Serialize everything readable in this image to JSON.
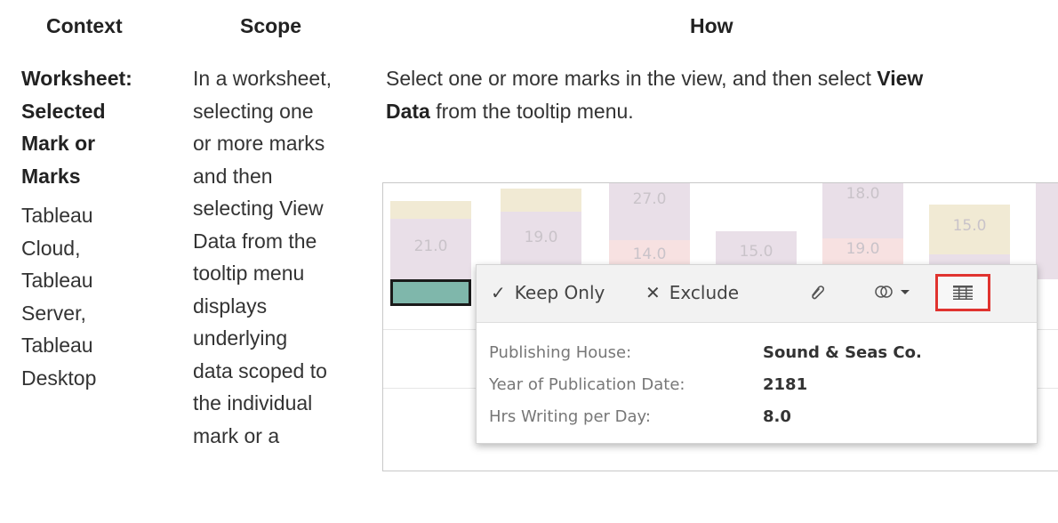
{
  "headers": {
    "context": "Context",
    "scope": "Scope",
    "how": "How"
  },
  "context": {
    "line1": "Worksheet:",
    "line2": "Selected",
    "line3": "Mark or",
    "line4": "Marks",
    "platforms": [
      "Tableau",
      "Cloud,",
      "Tableau",
      "Server,",
      "Tableau",
      "Desktop"
    ]
  },
  "scope": {
    "lines": [
      "In a worksheet,",
      "selecting one",
      "or more marks",
      "and then",
      "selecting View",
      "Data from the",
      "tooltip menu",
      "displays",
      "underlying",
      "data scoped to",
      "the individual",
      "mark or a"
    ]
  },
  "how": {
    "line1_pre": "Select one or more marks in the view, and then select ",
    "line1_bold": "View",
    "line2_bold": "Data",
    "line2_post": " from the tooltip menu."
  },
  "screenshot": {
    "bar_labels": {
      "b1": "21.0",
      "b2": "19.0",
      "b3a": "27.0",
      "b3b": "14.0",
      "b4": "15.0",
      "b5a": "18.0",
      "b5b": "19.0",
      "b6": "15.0"
    },
    "toolbar": {
      "keep_only": "Keep Only",
      "exclude": "Exclude",
      "keep_icon": "checkmark-icon",
      "exclude_icon": "x-icon",
      "group_icon": "paperclip-icon",
      "set_icon": "set-icon",
      "view_data_icon": "table-icon",
      "highlight": "#e0332f"
    },
    "tooltip_rows": [
      {
        "key": "Publishing House:",
        "value": "Sound & Seas Co."
      },
      {
        "key": "Year of Publication Date:",
        "value": "2181"
      },
      {
        "key": "Hrs Writing per Day:",
        "value": "8.0"
      }
    ]
  }
}
